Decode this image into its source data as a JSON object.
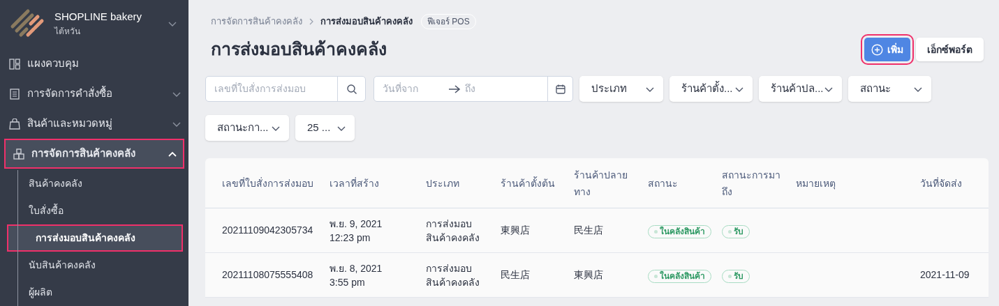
{
  "store": {
    "name": "SHOPLINE bakery",
    "region": "ไต้หวัน"
  },
  "sidebar": {
    "items": [
      {
        "label": "แผงควบคุม",
        "selected": false,
        "highlighted": false
      },
      {
        "label": "การจัดการคำสั่งซื้อ",
        "expanded": false,
        "selected": false,
        "highlighted": false
      },
      {
        "label": "สินค้าและหมวดหมู่",
        "expanded": false,
        "selected": false,
        "highlighted": false
      },
      {
        "label": "การจัดการสินค้าคงคลัง",
        "expanded": true,
        "selected": true,
        "highlighted": true,
        "children": [
          {
            "label": "สินค้าคงคลัง",
            "selected": false,
            "highlighted": false
          },
          {
            "label": "ใบสั่งซื้อ",
            "selected": false,
            "highlighted": false
          },
          {
            "label": "การส่งมอบสินค้าคงคลัง",
            "selected": true,
            "highlighted": true
          },
          {
            "label": "นับสินค้าคงคลัง",
            "selected": false,
            "highlighted": false
          },
          {
            "label": "ผู้ผลิต",
            "selected": false,
            "highlighted": false
          }
        ]
      }
    ]
  },
  "breadcrumb": [
    "การจัดการสินค้าคงคลัง",
    "การส่งมอบสินค้าคงคลัง"
  ],
  "feature_badge": "ฟีเจอร์ POS",
  "title": "การส่งมอบสินค้าคงคลัง",
  "add_button": {
    "label": "เพิ่ม",
    "highlighted": true
  },
  "export_button": "เอ็กซ์พอร์ต",
  "search": {
    "placeholder": "เลขที่ใบสั่งการส่งมอบ"
  },
  "date_range": {
    "from_placeholder": "วันที่จาก",
    "to_placeholder": "ถึง"
  },
  "filters": [
    {
      "label": "ประเภท"
    },
    {
      "label": "ร้านค้าตั้ง..."
    },
    {
      "label": "ร้านค้าปล..."
    },
    {
      "label": "สถานะ"
    },
    {
      "label": "สถานะกา..."
    },
    {
      "label": "25 ..."
    }
  ],
  "table": {
    "columns": [
      "เลขที่ใบสั่งการส่งมอบ",
      "เวลาที่สร้าง",
      "ประเภท",
      "ร้านค้าตั้งต้น",
      "ร้านค้าปลายทาง",
      "สถานะ",
      "สถานะการมาถึง",
      "หมายเหตุ",
      "วันที่จัดส่ง"
    ],
    "rows": [
      {
        "number": "20211109042305734",
        "created": [
          "พ.ย. 9, 2021",
          "12:23 pm"
        ],
        "type": [
          "การส่งมอบ",
          "สินค้าคงคลัง"
        ],
        "origin": "東興店",
        "destination": "民生店",
        "status": "ในคลังสินค้า",
        "arrival": "รับ"
      },
      {
        "number": "20211108075555408",
        "created": [
          "พ.ย. 8, 2021",
          "3:55 pm"
        ],
        "type": [
          "การส่งมอบ",
          "สินค้าคงคลัง"
        ],
        "origin": "民生店",
        "destination": "東興店",
        "status": "ในคลังสินค้า",
        "arrival": "รับ",
        "ship_date": "2021-11-09"
      }
    ]
  }
}
